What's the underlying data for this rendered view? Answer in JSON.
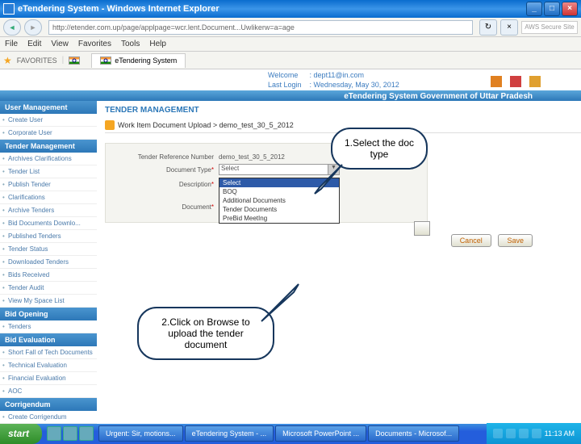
{
  "window": {
    "title": "eTendering System - Windows Internet Explorer"
  },
  "address": {
    "url": "http://etender.com.up/page/applpage=wcr.lent.Document...Uwlikerw=a=age"
  },
  "aws": "AWS Secure Site",
  "menu": [
    "File",
    "Edit",
    "View",
    "Favorites",
    "Tools",
    "Help"
  ],
  "fav": {
    "label": "FAVORITES",
    "tab": "eTendering System"
  },
  "welcome": {
    "l1": "Welcome",
    "v1": ": dept11@in.com",
    "l2": "Last Login",
    "v2": ": Wednesday, May 30, 2012"
  },
  "brand": "eTendering System Government of Uttar Pradesh",
  "sidebar": {
    "s1": {
      "title": "User Management",
      "items": [
        "Create User",
        "Corporate User"
      ]
    },
    "s2": {
      "title": "Tender Management",
      "items": [
        "Archives Clarifications",
        "Tender List",
        "Publish Tender",
        "Clarifications",
        "Archive Tenders",
        "Bid Documents Downlo...",
        "Published Tenders",
        "Tender Status",
        "Downloaded Tenders",
        "Bids Received",
        "Tender Audit",
        "View My Space List"
      ]
    },
    "s3": {
      "title": "Bid Opening",
      "items": [
        "Tenders"
      ]
    },
    "s4": {
      "title": "Bid Evaluation",
      "items": [
        "Short Fall of Tech Documents",
        "Technical Evaluation",
        "Financial Evaluation",
        "AOC"
      ]
    },
    "s5": {
      "title": "Corrigendum",
      "items": [
        "Create Corrigendum"
      ]
    }
  },
  "main": {
    "title": "TENDER MANAGEMENT",
    "crumb": "Work Item Document Upload > demo_test_30_5_2012",
    "refLabel": "Tender Reference Number",
    "refVal": "demo_test_30_5_2012",
    "docTypeLabel": "Document Type",
    "docTypeSel": "Select",
    "descLabel": "Description",
    "docLabel": "Document",
    "dropdown": [
      "Select",
      "BOQ",
      "Additional Documents",
      "Tender Documents",
      "PreBid MeetIng"
    ],
    "req": "*"
  },
  "buttons": {
    "cancel": "Cancel",
    "save": "Save"
  },
  "callouts": {
    "c1": "1.Select the doc type",
    "c2": "2.Click on Browse to upload the tender document"
  },
  "taskbar": {
    "start": "start",
    "tasks": [
      "Urgent: Sir, motions...",
      "eTendering System - ...",
      "Microsoft PowerPoint ...",
      "Documents - Microsof..."
    ],
    "time": "11:13 AM"
  }
}
